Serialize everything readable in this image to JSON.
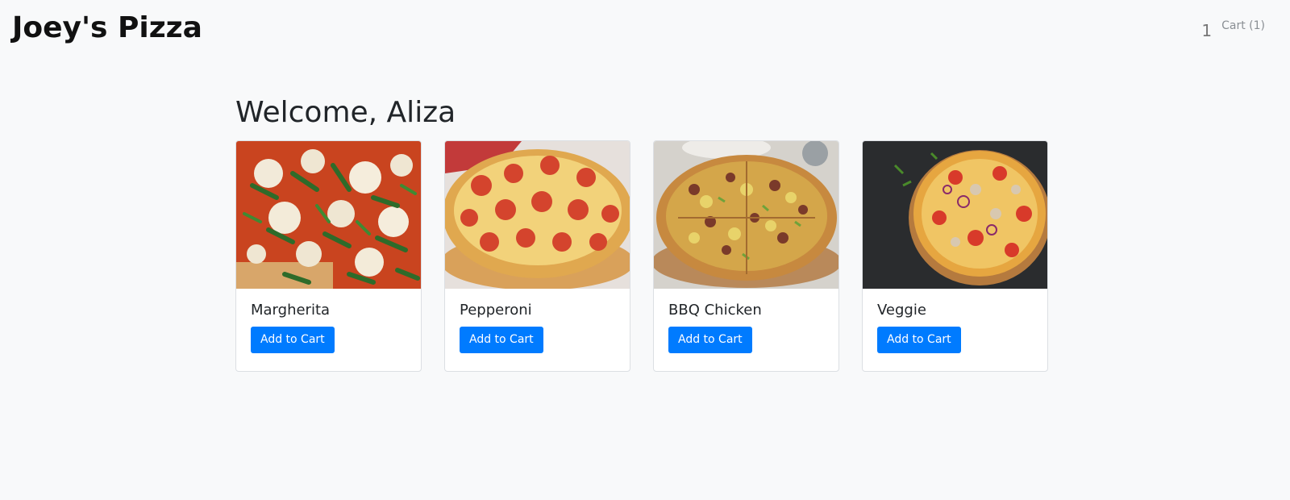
{
  "header": {
    "brand": "Joey's Pizza",
    "cart_icon": "1",
    "cart_label": "Cart (1)"
  },
  "main": {
    "welcome": "Welcome, Aliza",
    "products": [
      {
        "name": "Margherita",
        "button": "Add to Cart",
        "image_icon": "pizza-margherita-image"
      },
      {
        "name": "Pepperoni",
        "button": "Add to Cart",
        "image_icon": "pizza-pepperoni-image"
      },
      {
        "name": "BBQ Chicken",
        "button": "Add to Cart",
        "image_icon": "pizza-bbq-chicken-image"
      },
      {
        "name": "Veggie",
        "button": "Add to Cart",
        "image_icon": "pizza-veggie-image"
      }
    ]
  },
  "colors": {
    "background": "#f8f9fa",
    "button": "#007bff",
    "card_border": "#dcdfe3"
  }
}
